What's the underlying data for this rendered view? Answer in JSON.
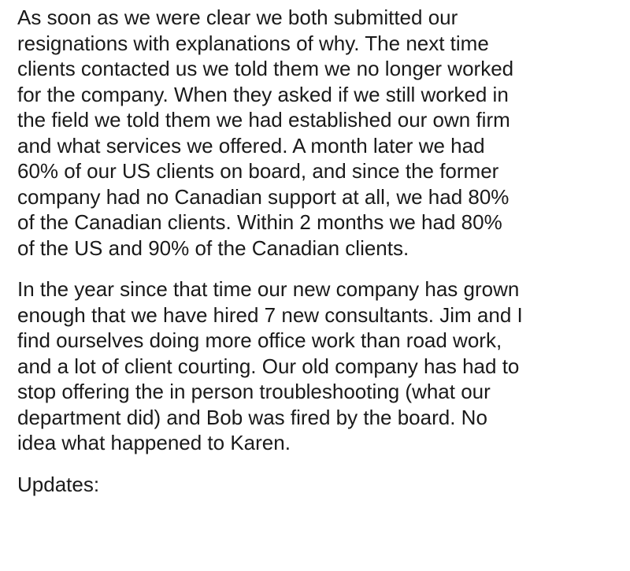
{
  "paragraphs": [
    {
      "lines": [
        "As soon as we were clear we both submitted our",
        "resignations with explanations of why. The next time",
        "clients contacted us we told them we no longer worked",
        "for the company.  When they asked if we still worked in",
        "the field we told them we had established our own firm",
        "and what services we offered.  A month later we had",
        "60% of our US clients on board, and since the former",
        "company had no Canadian support at all, we had 80%",
        "of the Canadian clients. Within 2 months we had 80%",
        "of the US and 90% of the Canadian clients."
      ]
    },
    {
      "lines": [
        "In the year since that time our new company has grown",
        "enough that we have hired 7 new consultants. Jim and I",
        "find ourselves doing more office work than road work,",
        "and a lot of client courting. Our old company has had to",
        "stop offering the in person troubleshooting (what our",
        "department did) and Bob was fired by the board.  No",
        "idea what happened to Karen."
      ]
    },
    {
      "lines": [
        "Updates:"
      ]
    }
  ]
}
